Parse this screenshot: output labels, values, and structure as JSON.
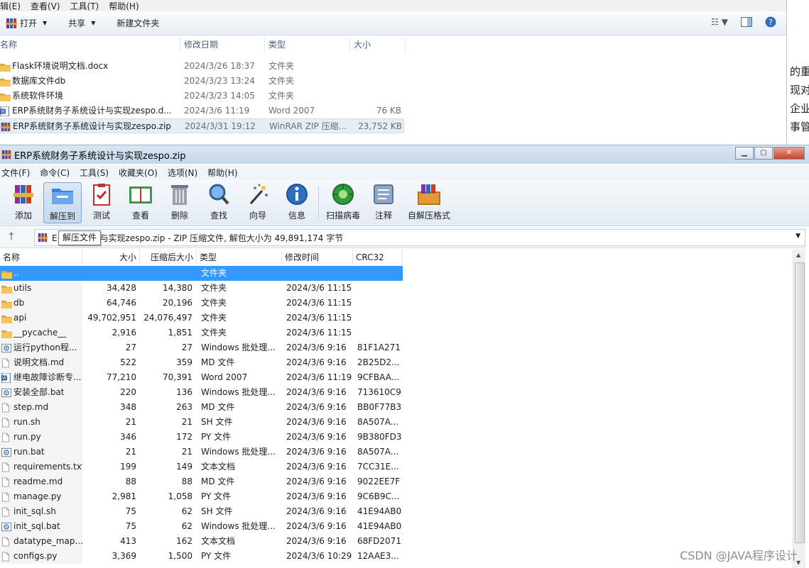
{
  "explorer": {
    "menu": [
      "辑(E)",
      "查看(V)",
      "工具(T)",
      "帮助(H)"
    ],
    "toolbar": {
      "open": "打开",
      "share": "共享",
      "new_folder": "新建文件夹"
    },
    "columns": [
      "名称",
      "修改日期",
      "类型",
      "大小"
    ],
    "rows": [
      {
        "name": "Flask环境说明文档.docx",
        "date": "2024/3/26 18:37",
        "type": "文件夹",
        "size": "",
        "icon": "folder-icon"
      },
      {
        "name": "数据库文件db",
        "date": "2024/3/23 13:24",
        "type": "文件夹",
        "size": "",
        "icon": "folder-icon"
      },
      {
        "name": "系统软件环境",
        "date": "2024/3/23 14:05",
        "type": "文件夹",
        "size": "",
        "icon": "folder-icon"
      },
      {
        "name": "ERP系统财务子系统设计与实现zespo.d...",
        "date": "2024/3/6 11:19",
        "type": "Word 2007",
        "size": "76 KB",
        "icon": "word-icon"
      },
      {
        "name": "ERP系统财务子系统设计与实现zespo.zip",
        "date": "2024/3/31 19:12",
        "type": "WinRAR ZIP 压缩...",
        "size": "23,752 KB",
        "icon": "winrar-icon"
      }
    ]
  },
  "side_text": [
    "的重",
    "现对",
    "企业",
    "事管"
  ],
  "winrar": {
    "title": "ERP系统财务子系统设计与实现zespo.zip",
    "menu": [
      "文件(F)",
      "命令(C)",
      "工具(S)",
      "收藏夹(O)",
      "选项(N)",
      "帮助(H)"
    ],
    "toolbar": [
      "添加",
      "解压到",
      "测试",
      "查看",
      "删除",
      "查找",
      "向导",
      "信息",
      "扫描病毒",
      "注释",
      "自解压格式"
    ],
    "address_text": "E子系统设计与实现zespo.zip - ZIP 压缩文件, 解包大小为 49,891,174 字节",
    "tooltip": "解压文件",
    "columns": [
      "名称",
      "大小",
      "压缩后大小",
      "类型",
      "修改时间",
      "CRC32"
    ],
    "rows": [
      {
        "name": "..",
        "size": "",
        "packed": "",
        "type": "文件夹",
        "mtime": "",
        "crc": "",
        "icon": "folder-icon"
      },
      {
        "name": "utils",
        "size": "34,428",
        "packed": "14,380",
        "type": "文件夹",
        "mtime": "2024/3/6 11:15",
        "crc": "",
        "icon": "folder-icon"
      },
      {
        "name": "db",
        "size": "64,746",
        "packed": "20,196",
        "type": "文件夹",
        "mtime": "2024/3/6 11:15",
        "crc": "",
        "icon": "folder-icon"
      },
      {
        "name": "api",
        "size": "49,702,951",
        "packed": "24,076,497",
        "type": "文件夹",
        "mtime": "2024/3/6 11:15",
        "crc": "",
        "icon": "folder-icon"
      },
      {
        "name": "__pycache__",
        "size": "2,916",
        "packed": "1,851",
        "type": "文件夹",
        "mtime": "2024/3/6 11:15",
        "crc": "",
        "icon": "folder-icon"
      },
      {
        "name": "运行python程...",
        "size": "27",
        "packed": "27",
        "type": "Windows 批处理...",
        "mtime": "2024/3/6 9:16",
        "crc": "81F1A271",
        "icon": "batch-icon"
      },
      {
        "name": "说明文档.md",
        "size": "522",
        "packed": "359",
        "type": "MD 文件",
        "mtime": "2024/3/6 9:16",
        "crc": "2B25D2...",
        "icon": "file-icon"
      },
      {
        "name": "继电故障诊断专...",
        "size": "77,210",
        "packed": "70,391",
        "type": "Word 2007",
        "mtime": "2024/3/6 11:19",
        "crc": "9CFBAA...",
        "icon": "word-icon"
      },
      {
        "name": "安装全部.bat",
        "size": "220",
        "packed": "136",
        "type": "Windows 批处理...",
        "mtime": "2024/3/6 9:16",
        "crc": "713610C9",
        "icon": "batch-icon"
      },
      {
        "name": "step.md",
        "size": "348",
        "packed": "263",
        "type": "MD 文件",
        "mtime": "2024/3/6 9:16",
        "crc": "BB0F77B3",
        "icon": "file-icon"
      },
      {
        "name": "run.sh",
        "size": "21",
        "packed": "21",
        "type": "SH 文件",
        "mtime": "2024/3/6 9:16",
        "crc": "8A507A...",
        "icon": "file-icon"
      },
      {
        "name": "run.py",
        "size": "346",
        "packed": "172",
        "type": "PY 文件",
        "mtime": "2024/3/6 9:16",
        "crc": "9B380FD3",
        "icon": "file-icon"
      },
      {
        "name": "run.bat",
        "size": "21",
        "packed": "21",
        "type": "Windows 批处理...",
        "mtime": "2024/3/6 9:16",
        "crc": "8A507A...",
        "icon": "batch-icon"
      },
      {
        "name": "requirements.txt",
        "size": "199",
        "packed": "149",
        "type": "文本文档",
        "mtime": "2024/3/6 9:16",
        "crc": "7CC31E...",
        "icon": "file-icon"
      },
      {
        "name": "readme.md",
        "size": "88",
        "packed": "88",
        "type": "MD 文件",
        "mtime": "2024/3/6 9:16",
        "crc": "9022EE7F",
        "icon": "file-icon"
      },
      {
        "name": "manage.py",
        "size": "2,981",
        "packed": "1,058",
        "type": "PY 文件",
        "mtime": "2024/3/6 9:16",
        "crc": "9C6B9C...",
        "icon": "file-icon"
      },
      {
        "name": "init_sql.sh",
        "size": "75",
        "packed": "62",
        "type": "SH 文件",
        "mtime": "2024/3/6 9:16",
        "crc": "41E94AB0",
        "icon": "file-icon"
      },
      {
        "name": "init_sql.bat",
        "size": "75",
        "packed": "62",
        "type": "Windows 批处理...",
        "mtime": "2024/3/6 9:16",
        "crc": "41E94AB0",
        "icon": "batch-icon"
      },
      {
        "name": "datatype_map....",
        "size": "413",
        "packed": "162",
        "type": "文本文档",
        "mtime": "2024/3/6 9:16",
        "crc": "68FD2071",
        "icon": "file-icon"
      },
      {
        "name": "configs.py",
        "size": "3,369",
        "packed": "1,500",
        "type": "PY 文件",
        "mtime": "2024/3/6 10:29",
        "crc": "12AAE3...",
        "icon": "file-icon"
      }
    ]
  },
  "watermark": "CSDN @JAVA程序设计",
  "colors": {
    "selection": "#3399ff",
    "folder": "#e8b84a",
    "titlebar": "#c6d7ea"
  }
}
